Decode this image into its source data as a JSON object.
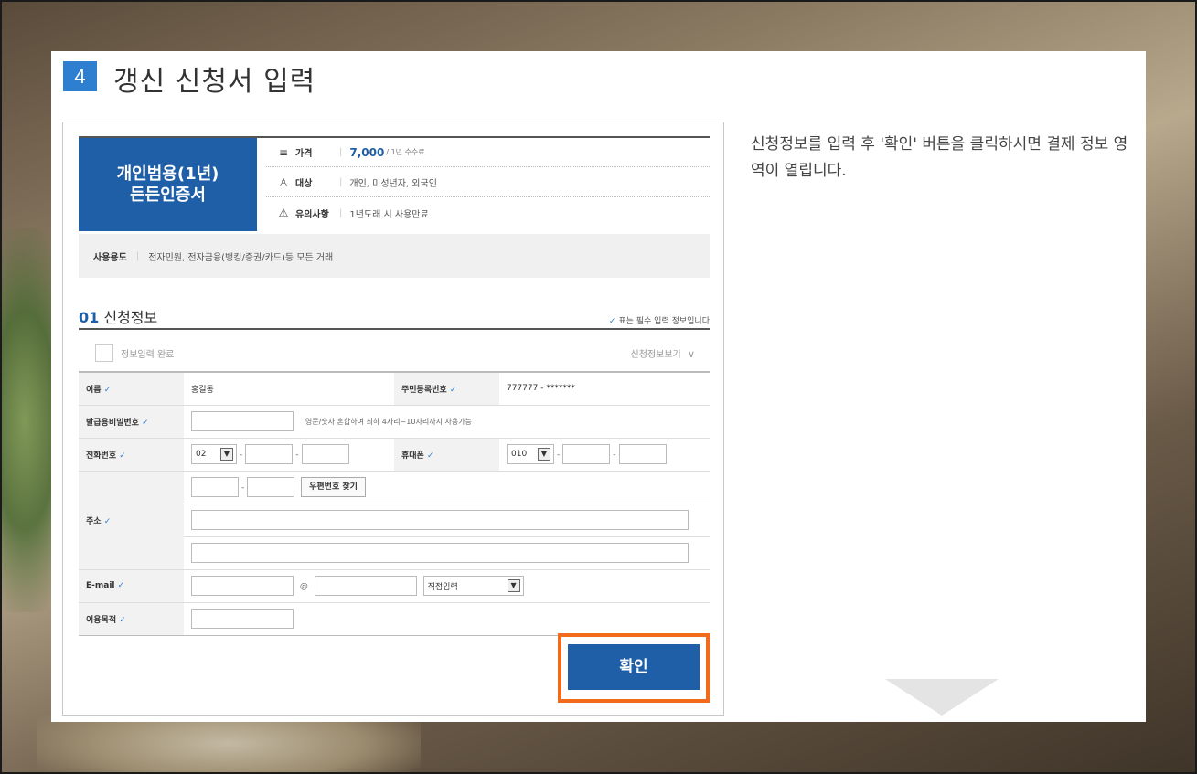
{
  "step": {
    "number": "4",
    "title": "갱신 신청서 입력"
  },
  "description": "신청정보를 입력 후 '확인' 버튼을 클릭하시면 결제 정보 영역이 열립니다.",
  "product": {
    "name_line1": "개인범용(1년)",
    "name_line2": "든든인증서",
    "price_label": "가격",
    "price_value": "7,000",
    "price_unit": "/ 1년 수수료",
    "target_label": "대상",
    "target_value": "개인, 미성년자, 외국인",
    "notice_label": "유의사항",
    "notice_value": "1년도래 시 사용만료",
    "usage_label": "사용용도",
    "usage_value": "전자민원, 전자금융(뱅킹/증권/카드)등 모든 거래"
  },
  "section": {
    "number": "01",
    "title": "신청정보",
    "required_note": "표는 필수 입력 정보입니다",
    "done_label": "정보입력 완료",
    "view_toggle": "신청정보보기"
  },
  "form": {
    "name_label": "이름",
    "name_value": "홍길동",
    "rrn_label": "주민등록번호",
    "rrn_value": "777777 - *******",
    "pw_label": "발급용비밀번호",
    "pw_help": "영문/숫자 혼합하여 최하 4자리~10자리까지 사용가능",
    "phone_label": "전화번호",
    "phone_area": "02",
    "mobile_label": "휴대폰",
    "mobile_prefix": "010",
    "address_label": "주소",
    "zip_button": "우편번호 찾기",
    "email_label": "E-mail",
    "email_at": "@",
    "email_domain": "직접입력",
    "purpose_label": "이용목적"
  },
  "confirm_button": "확인",
  "accent_colors": {
    "badge": "#2f7fd0",
    "product": "#1f5fa8",
    "highlight": "#f26a1b"
  }
}
